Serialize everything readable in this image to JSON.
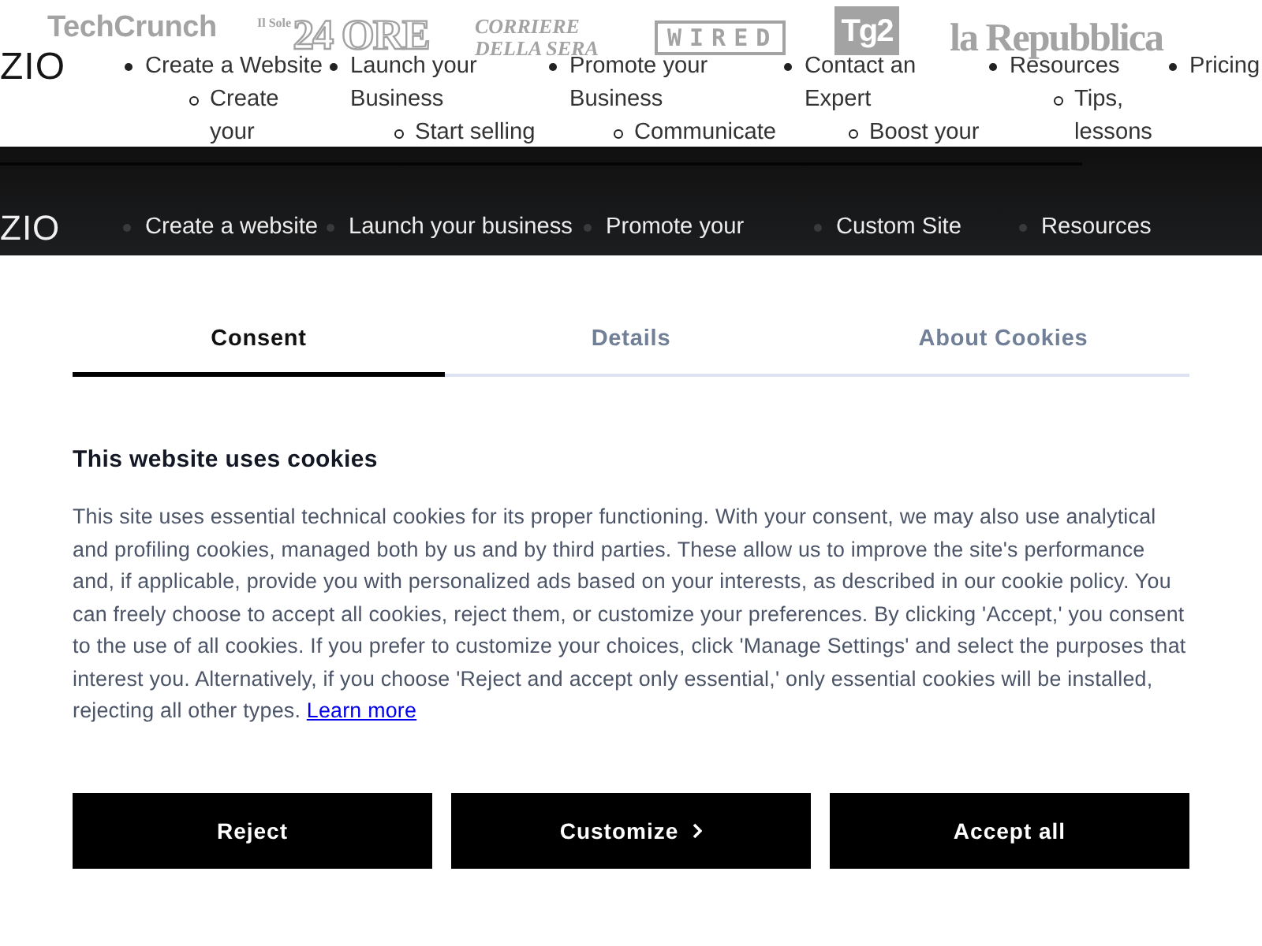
{
  "page_header": {
    "logo": "ZIO",
    "press_logos": [
      {
        "kind": "bold-sans",
        "text": "TechCrunch"
      },
      {
        "kind": "masthead",
        "small_text": "Il Sole",
        "text": "24 ORE"
      },
      {
        "kind": "italic-serif",
        "lines": [
          "CORRIERE",
          "DELLA SERA"
        ]
      },
      {
        "kind": "boxed",
        "text": "WIRED"
      },
      {
        "kind": "tile",
        "text": "Tg2"
      },
      {
        "kind": "serif",
        "text": "la Repubblica"
      }
    ],
    "menu": [
      {
        "label": "Create a Website",
        "children": [
          {
            "label": "Create your"
          }
        ]
      },
      {
        "label": "Launch your Business",
        "children": [
          {
            "label": "Start selling"
          }
        ]
      },
      {
        "label": "Promote your Business",
        "children": [
          {
            "label": "Communicate"
          }
        ]
      },
      {
        "label": "Contact an Expert",
        "children": [
          {
            "label": "Boost your"
          }
        ]
      },
      {
        "label": "Resources",
        "children": [
          {
            "label": "Tips, lessons"
          }
        ]
      },
      {
        "label": "Pricing"
      }
    ]
  },
  "dark_header": {
    "logo": "ZIO",
    "menu": [
      {
        "label": "Create a website"
      },
      {
        "label": "Launch your business"
      },
      {
        "label": "Promote your"
      },
      {
        "label": "Custom Site"
      },
      {
        "label": "Resources"
      }
    ]
  },
  "cookie_dialog": {
    "tabs": [
      {
        "label": "Consent",
        "selected": true
      },
      {
        "label": "Details",
        "selected": false
      },
      {
        "label": "About Cookies",
        "selected": false
      }
    ],
    "title": "This website uses cookies",
    "text": "This site uses essential technical cookies for its proper functioning. With your consent, we may also use analytical and profiling cookies, managed both by us and by third parties. These allow us to improve the site's performance and, if applicable, provide you with personalized ads based on your interests, as described in our cookie policy. You can freely choose to accept all cookies, reject them, or customize your preferences. By clicking 'Accept,' you consent to the use of all cookies. If you prefer to customize your choices, click 'Manage Settings' and select the purposes that interest you. Alternatively, if you choose 'Reject and accept only essential,' only essential cookies will be installed, rejecting all other types.",
    "link": "Learn more",
    "buttons": [
      {
        "label": "Reject",
        "kind": "plain"
      },
      {
        "label": "Customize",
        "kind": "chevron"
      },
      {
        "label": "Accept all",
        "kind": "plain"
      }
    ]
  }
}
